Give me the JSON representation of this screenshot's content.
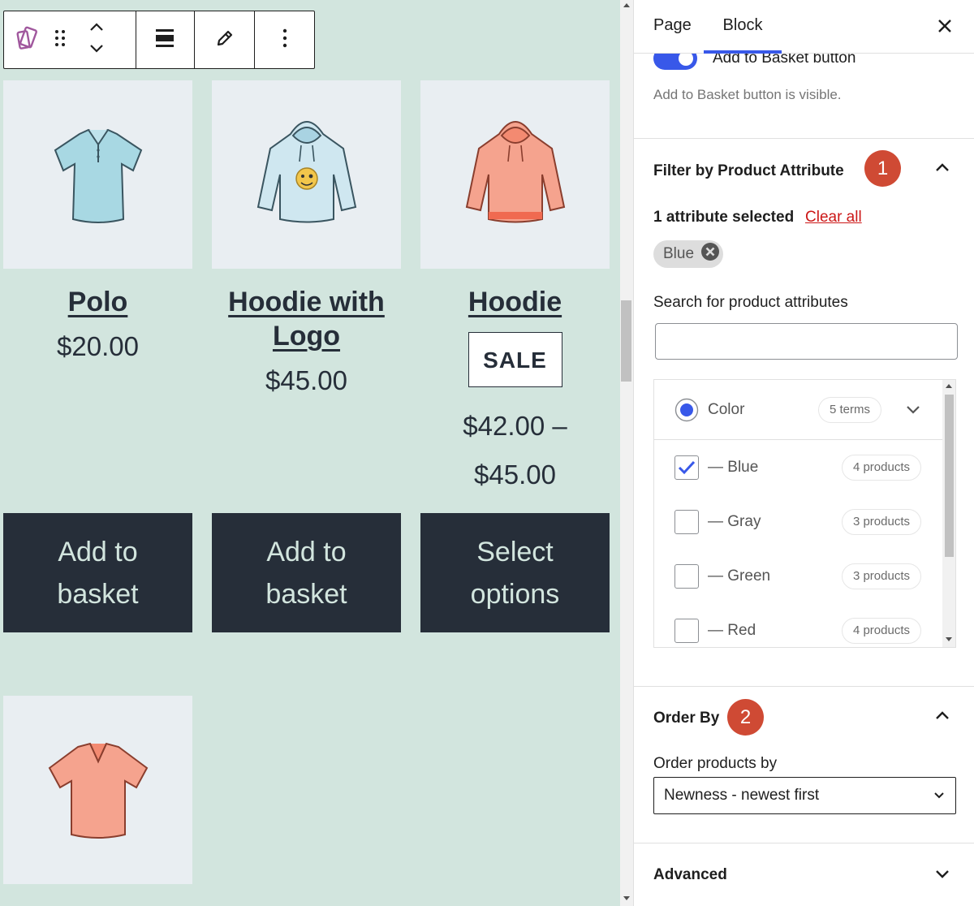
{
  "toolbar": {
    "block_icon": "product-collection-icon",
    "drag_icon": "drag-handle-icon",
    "move_up_icon": "chevron-up-icon",
    "move_down_icon": "chevron-down-icon",
    "align_icon": "align-wide-icon",
    "edit_icon": "pencil-icon",
    "more_icon": "more-vertical-icon"
  },
  "products": [
    {
      "title": "Polo",
      "price": "$20.00",
      "button": "Add to basket",
      "image": "polo-shirt"
    },
    {
      "title": "Hoodie with Logo",
      "price": "$45.00",
      "button": "Add to basket",
      "image": "hoodie-with-logo"
    },
    {
      "title": "Hoodie",
      "badge": "SALE",
      "price_line1": "$42.00 –",
      "price_line2": "$45.00",
      "button": "Select options",
      "image": "hoodie"
    },
    {
      "image": "v-neck-t-shirt"
    }
  ],
  "sidebar": {
    "tabs": [
      "Page",
      "Block"
    ],
    "active_tab": "Block",
    "close_icon": "close-icon",
    "basket_toggle": {
      "label": "Add to Basket button",
      "help": "Add to Basket button is visible.",
      "on": true
    },
    "filter": {
      "title": "Filter by Product Attribute",
      "badge": "1",
      "selected_text": "1 attribute selected",
      "clear_all": "Clear all",
      "chip": "Blue",
      "search_label": "Search for product attributes",
      "search_value": "",
      "group": {
        "label": "Color",
        "count": "5 terms"
      },
      "terms": [
        {
          "label": "— Blue",
          "count": "4 products",
          "checked": true
        },
        {
          "label": "— Gray",
          "count": "3 products",
          "checked": false
        },
        {
          "label": "— Green",
          "count": "3 products",
          "checked": false
        },
        {
          "label": "— Red",
          "count": "4 products",
          "checked": false
        }
      ]
    },
    "order": {
      "title": "Order By",
      "badge": "2",
      "label": "Order products by",
      "selected": "Newness - newest first"
    },
    "advanced": {
      "title": "Advanced"
    }
  },
  "colors": {
    "canvas_bg": "#d2e5de",
    "button_bg": "#262e39",
    "accent": "#3858e9",
    "badge": "#cf4a34"
  }
}
